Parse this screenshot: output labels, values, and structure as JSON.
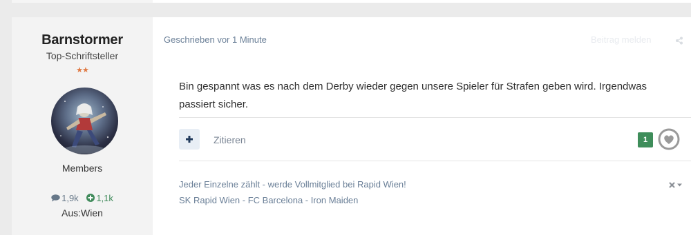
{
  "author": {
    "name": "Barnstormer",
    "title": "Top-Schriftsteller",
    "stars": "★★",
    "group": "Members",
    "posts_count": "1,9k",
    "reputation": "1,1k",
    "location": "Aus:Wien"
  },
  "post": {
    "meta": "Geschrieben vor 1 Minute",
    "report_label": "Beitrag melden",
    "content": "Bin gespannt was es nach dem Derby wieder gegen unsere Spieler für Strafen geben wird. Irgendwas passiert sicher.",
    "quote_label": "Zitieren",
    "reaction_count": "1"
  },
  "signature": {
    "line1": "Jeder Einzelne zählt - werde Vollmitglied bei Rapid Wien!",
    "line2": "SK Rapid Wien - FC Barcelona - Iron Maiden"
  },
  "icons": {
    "posts": "comment-icon",
    "reputation": "plus-circle-icon",
    "share": "share-icon",
    "add": "plus-icon",
    "like": "heart-icon",
    "close": "close-icon",
    "dropdown": "caret-down-icon"
  },
  "colors": {
    "reaction_green": "#3e8d5a",
    "meta_blue": "#6a7f97",
    "star_orange": "#e07a44",
    "plus_navy": "#213a5c"
  }
}
